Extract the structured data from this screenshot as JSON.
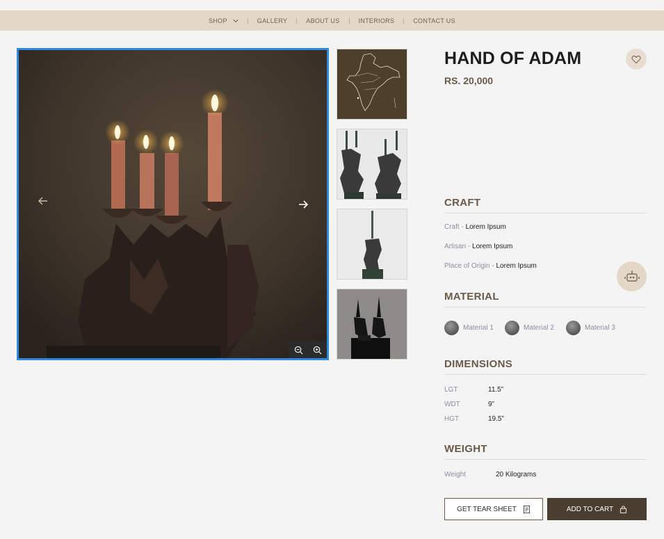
{
  "nav": {
    "items": [
      {
        "label": "SHOP"
      },
      {
        "label": "GALLERY"
      },
      {
        "label": "ABOUT US"
      },
      {
        "label": "INTERIORS"
      },
      {
        "label": "CONTACT US"
      }
    ]
  },
  "gallery": {
    "main_image": "Candles in hand-shaped holders",
    "thumbnails": [
      "india-map",
      "hand-candle-holders-pair",
      "hand-candle-holder-single",
      "hand-silhouettes-dark"
    ],
    "icons": {
      "prev": "arrow-left-icon",
      "next": "arrow-right-icon",
      "zoom_out": "zoom-out-icon",
      "zoom_in": "zoom-in-icon"
    }
  },
  "product": {
    "title": "HAND OF ADAM",
    "price": "RS. 20,000",
    "wishlist_icon": "heart-icon"
  },
  "craft": {
    "heading": "CRAFT",
    "rows": [
      {
        "key": "Craft - ",
        "value": "Lorem Ipsum"
      },
      {
        "key": "Artisan - ",
        "value": "Lorem Ipsum"
      },
      {
        "key": "Place of Origin - ",
        "value": "Lorem Ipsum"
      }
    ]
  },
  "material": {
    "heading": "MATERIAL",
    "items": [
      "Material 1",
      "Material 2",
      "Material 3"
    ]
  },
  "dimensions": {
    "heading": "DIMENSIONS",
    "rows": [
      {
        "key": "LGT",
        "value": "11.5”"
      },
      {
        "key": "WDT",
        "value": "9”"
      },
      {
        "key": "HGT",
        "value": "19.5”"
      }
    ]
  },
  "weight": {
    "heading": "WEIGHT",
    "key": "Weight",
    "value": "20 Kilograms"
  },
  "actions": {
    "tear_sheet": "GET TEAR SHEET",
    "add_to_cart": "ADD TO CART"
  },
  "colors": {
    "nav_bg": "#e3d8c6",
    "accent": "#6a5a4a",
    "cart_bg": "#4a3e30",
    "selection_border": "#2c8ae0"
  }
}
